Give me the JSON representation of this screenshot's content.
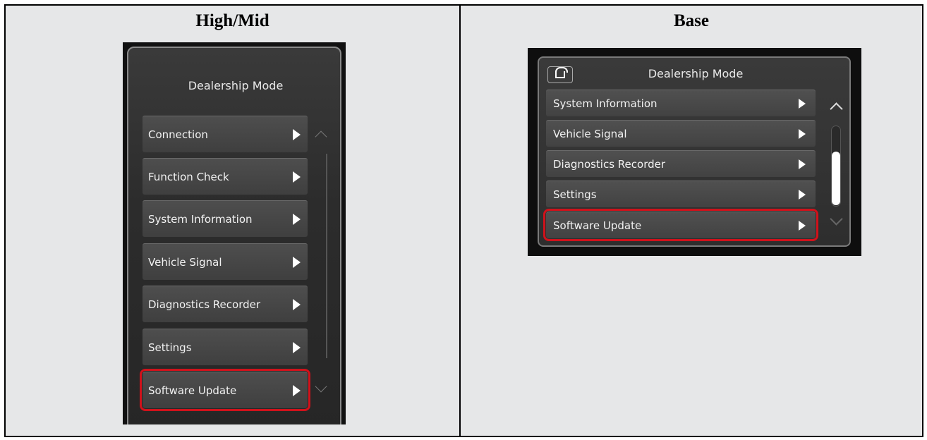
{
  "headings": {
    "left": "High/Mid",
    "right": "Base"
  },
  "high_mid": {
    "title": "Dealership Mode",
    "items": [
      {
        "label": "Connection"
      },
      {
        "label": "Function Check"
      },
      {
        "label": "System Information"
      },
      {
        "label": "Vehicle Signal"
      },
      {
        "label": "Diagnostics Recorder"
      },
      {
        "label": "Settings"
      },
      {
        "label": "Software Update",
        "highlighted": true
      }
    ]
  },
  "base": {
    "title": "Dealership Mode",
    "home_icon": "home-icon",
    "items": [
      {
        "label": "System Information"
      },
      {
        "label": "Vehicle Signal"
      },
      {
        "label": "Diagnostics Recorder"
      },
      {
        "label": "Settings"
      },
      {
        "label": "Software Update",
        "highlighted": true
      }
    ]
  },
  "colors": {
    "highlight": "#d0121b",
    "cell_background": "#e6e7e8"
  }
}
